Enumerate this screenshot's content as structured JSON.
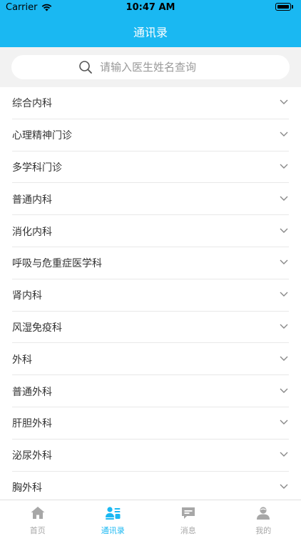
{
  "status_bar": {
    "carrier": "Carrier",
    "time": "10:47 AM"
  },
  "nav": {
    "title": "通讯录"
  },
  "search": {
    "placeholder": "请输入医生姓名查询",
    "value": ""
  },
  "departments": [
    {
      "label": "综合内科"
    },
    {
      "label": "心理精神门诊"
    },
    {
      "label": "多学科门诊"
    },
    {
      "label": "普通内科"
    },
    {
      "label": "消化内科"
    },
    {
      "label": "呼吸与危重症医学科"
    },
    {
      "label": "肾内科"
    },
    {
      "label": "风湿免疫科"
    },
    {
      "label": "外科"
    },
    {
      "label": "普通外科"
    },
    {
      "label": "肝胆外科"
    },
    {
      "label": "泌尿外科"
    },
    {
      "label": "胸外科"
    }
  ],
  "tabs": [
    {
      "label": "首页",
      "icon": "home-icon",
      "active": false
    },
    {
      "label": "通讯录",
      "icon": "contacts-icon",
      "active": true
    },
    {
      "label": "消息",
      "icon": "message-icon",
      "active": false
    },
    {
      "label": "我的",
      "icon": "profile-icon",
      "active": false
    }
  ],
  "colors": {
    "brand": "#1ab8f2",
    "inactive_tab": "#a7a7a7",
    "background": "#f2f2f2"
  }
}
